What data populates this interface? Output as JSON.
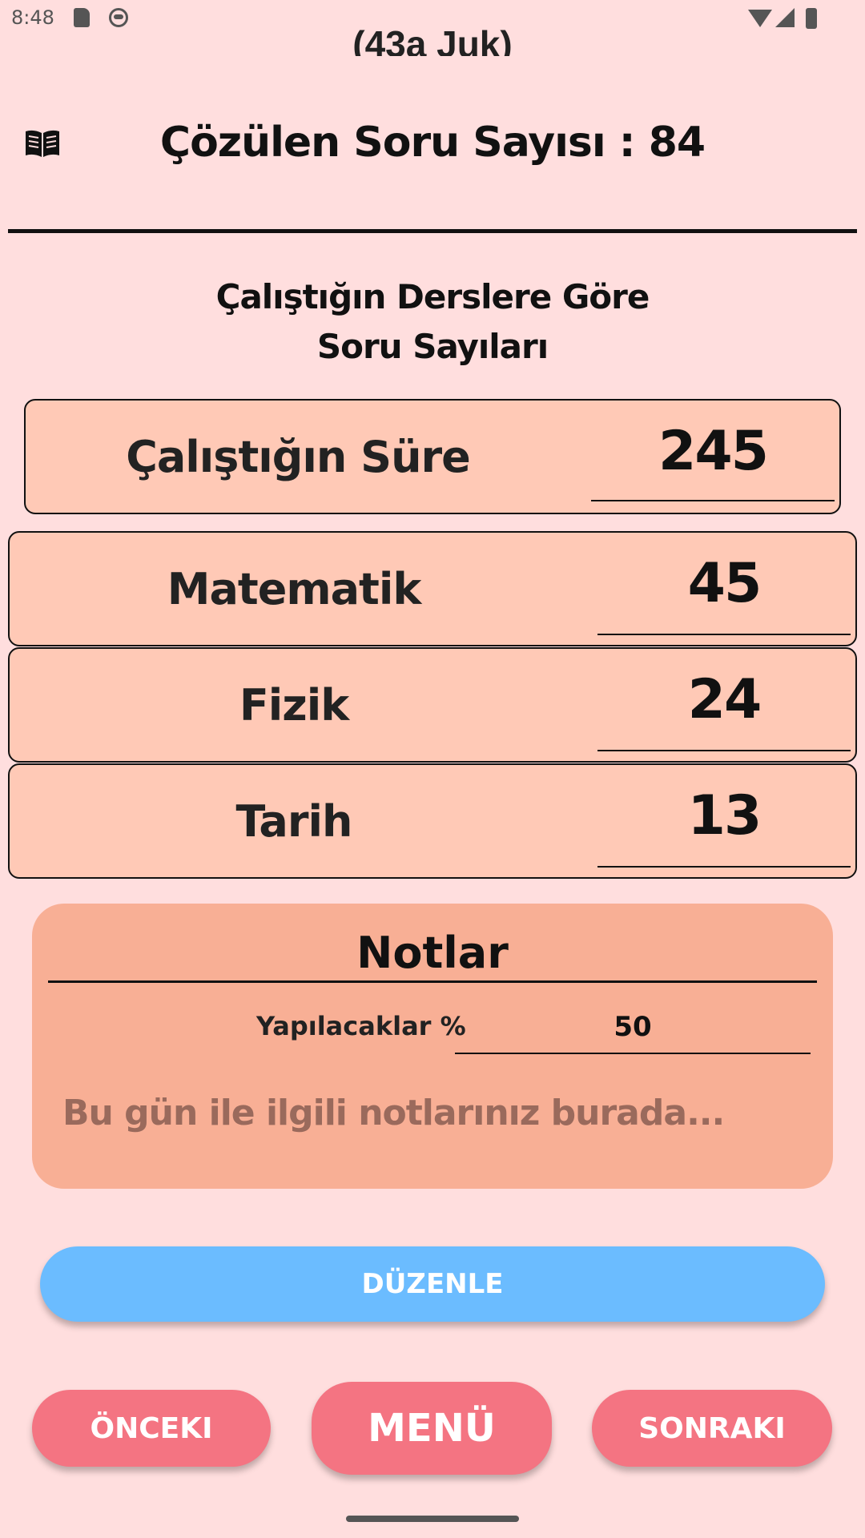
{
  "status_bar": {
    "time": "8:48"
  },
  "header": {
    "top_cut_text": "(43a Juk)",
    "solved_count": "Çözülen Soru Sayısı : 84"
  },
  "section": {
    "title_line1": "Çalıştığın Derslere Göre",
    "title_line2": "Soru Sayıları"
  },
  "rows": [
    {
      "label": "Çalıştığın Süre",
      "value": "245"
    },
    {
      "label": "Matematik",
      "value": "45"
    },
    {
      "label": "Fizik",
      "value": "24"
    },
    {
      "label": "Tarih",
      "value": "13"
    }
  ],
  "notes": {
    "title": "Notlar",
    "todo_label": "Yapılacaklar %",
    "todo_value": "50",
    "placeholder": "Bu gün ile ilgili notlarınız burada..."
  },
  "buttons": {
    "edit": "DÜZENLE",
    "prev": "ÖNCEKI",
    "menu": "MENÜ",
    "next": "SONRAKI"
  },
  "colors": {
    "background": "#ffdede",
    "row_fill": "#ffc9b6",
    "notes_fill": "#f8af95",
    "edit_button": "#6bbcff",
    "nav_button": "#f47482"
  },
  "icons": [
    "sd-card-icon",
    "face-icon",
    "wifi-icon",
    "signal-icon",
    "battery-icon",
    "book-icon"
  ]
}
